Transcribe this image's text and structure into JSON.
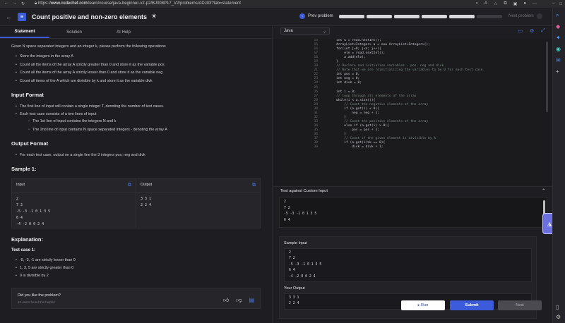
{
  "browser": {
    "url_prefix": "https://",
    "url_host": "www.codechef.com",
    "url_path": "/learn/course/java-beginner-v2-p2/BJ008P17_V2/problems/ADJ03?tab=statement"
  },
  "header": {
    "title": "Count positive and non-zero elements",
    "prev_label": "Prev problem",
    "next_label": "Next problem"
  },
  "tabs": [
    "Statement",
    "Solution",
    "AI Help"
  ],
  "statement": {
    "intro": "Given N space separated integers and an integer k, please perform the following operations",
    "operations": [
      "Store the integers in the array A",
      "Count all the items of the array A strictly greater than 0 and store it as the variable pos",
      "Count all the items of the array A strictly lesser than 0 and store it as the variable neg",
      "Count all items of the A which are divisible by k and store it as the variable divk"
    ],
    "input_title": "Input Format",
    "input_items": [
      "The first line of input will contain a single integer T, denoting the number of test cases.",
      "Each test case consists of a two lines of input"
    ],
    "input_sub": [
      "The 1st line of input contains the integers N and k",
      "The 2nd line of input contains N space separated integers - denoting the array A"
    ],
    "output_title": "Output Format",
    "output_items": [
      "For each test case, output on a single line the 3 integers pos, neg and divk"
    ],
    "sample_title": "Sample 1:",
    "sample_input_label": "Input",
    "sample_output_label": "Output",
    "sample_input_lines": [
      "2",
      "7 2",
      "-5 -3 -1 0 1 3 5",
      "6 4",
      "-4 -2 0 0 2 4"
    ],
    "sample_output_lines": [
      "3 3 1",
      "2 2 4"
    ],
    "explanation_title": "Explanation:",
    "test_case_label": "Test case 1:",
    "explanation_items": [
      "-5, -3, -1 are strictly lesser than 0",
      "1, 3, 5 are strictly greater than 0",
      "0 is divisible by 2"
    ],
    "feedback_question": "Did you like the problem?",
    "feedback_count": "16 users found this helpful"
  },
  "editor": {
    "language": "Java",
    "code": [
      {
        "n": "14",
        "t": "        int k = read.nextInt();",
        "c": false
      },
      {
        "n": "15",
        "t": "        ArrayList<Integer> a = new ArrayList<Integer>();",
        "c": false
      },
      {
        "n": "16",
        "t": "        for(int j=0; j<n; j++){",
        "c": false
      },
      {
        "n": "17",
        "t": "            ele = read.nextInt();",
        "c": false
      },
      {
        "n": "18",
        "t": "            a.add(ele);",
        "c": false
      },
      {
        "n": "19",
        "t": "        }",
        "c": false
      },
      {
        "n": "20",
        "t": "        // Declare and initialise variables - pos, neg and divk",
        "c": true
      },
      {
        "n": "21",
        "t": "        // Note that we are reinitializing the variables to be 0 for each test case.",
        "c": true
      },
      {
        "n": "22",
        "t": "        int pos = 0;",
        "c": false
      },
      {
        "n": "23",
        "t": "        int neg = 0;",
        "c": false
      },
      {
        "n": "24",
        "t": "        int divk = 0;",
        "c": false
      },
      {
        "n": "25",
        "t": "",
        "c": false
      },
      {
        "n": "26",
        "t": "        int i = 0;",
        "c": false
      },
      {
        "n": "27",
        "t": "        // loop through all elements of the array",
        "c": true
      },
      {
        "n": "28",
        "t": "        while(i < a.size()){",
        "c": false
      },
      {
        "n": "29",
        "t": "            // Count the negative elements of the array",
        "c": true
      },
      {
        "n": "30",
        "t": "            if (a.get(i) < 0){",
        "c": false
      },
      {
        "n": "31",
        "t": "                neg = neg + 1;",
        "c": false
      },
      {
        "n": "32",
        "t": "            }",
        "c": false
      },
      {
        "n": "33",
        "t": "            // Count the positive elements of the array",
        "c": true
      },
      {
        "n": "34",
        "t": "            else if (a.get(i) > 0){",
        "c": false
      },
      {
        "n": "35",
        "t": "                pos = pos + 1;",
        "c": false
      },
      {
        "n": "36",
        "t": "            }",
        "c": false
      },
      {
        "n": "37",
        "t": "            // Count if the given element is divisible by k",
        "c": true
      },
      {
        "n": "38",
        "t": "            if (a.get(i)%k == 0){",
        "c": false
      },
      {
        "n": "39",
        "t": "                divk = divk + 1;",
        "c": false
      }
    ]
  },
  "custom": {
    "title": "Test against Custom Input",
    "input_lines": [
      "2",
      "7 2",
      "-5 -3 -1 0 1 3 5",
      "6 4"
    ],
    "sample_input_label": "Sample Input",
    "sample_input_lines": [
      "2",
      "7 2",
      "-5 -3 -1 0 1 3 5",
      "6 4",
      "-4 -2 0 0 2 4"
    ],
    "your_output_label": "Your Output",
    "your_output_lines": [
      "3 3 1",
      "2 2 4"
    ]
  },
  "footer": {
    "run_label": "Run",
    "submit_label": "Submit",
    "next_label": "Next"
  },
  "progress": {
    "segments_completed": 5,
    "segments_total": 6
  }
}
